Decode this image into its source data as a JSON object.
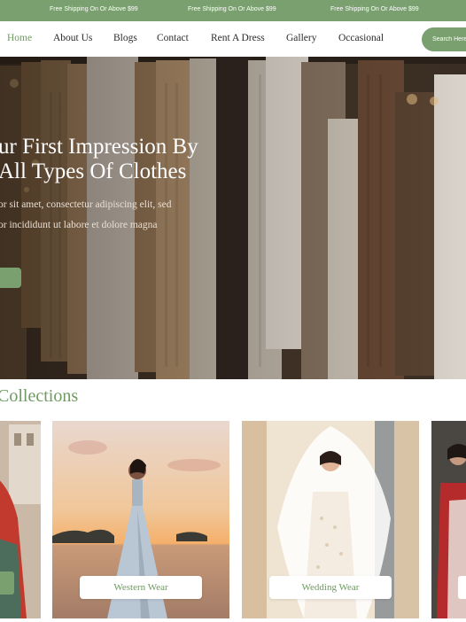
{
  "topbar": {
    "promos": [
      "Free Shipping On Or Above $99",
      "Free Shipping On Or Above $99",
      "Free Shipping On Or Above $99"
    ]
  },
  "nav": {
    "items": [
      "Home",
      "About Us",
      "Blogs",
      "Contact",
      "Rent A Dress",
      "Gallery",
      "Occasional"
    ],
    "active": "Home",
    "search_placeholder": "Search Here"
  },
  "hero": {
    "title_line1": "ur First Impression By",
    "title_line2": "All Types Of Clothes",
    "subtitle_line1": "or sit amet, consectetur adipiscing elit, sed",
    "subtitle_line2": "or incididunt ut labore et dolore magna"
  },
  "collections": {
    "heading": "Collections",
    "cards": [
      "Western Wear",
      "Wedding Wear"
    ]
  },
  "colors": {
    "accent": "#7ba06f",
    "accent_text": "#6f9a62"
  }
}
